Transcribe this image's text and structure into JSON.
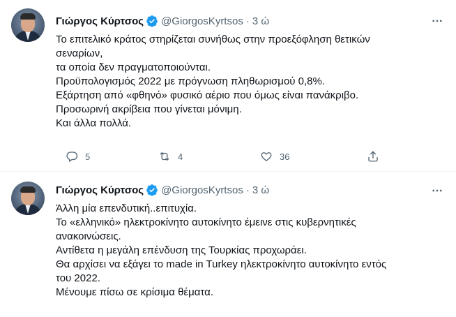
{
  "tweets": [
    {
      "author_name": "Γιώργος Κύρτσος",
      "handle": "@GiorgosKyrtsos",
      "separator": "·",
      "time": "3 ώ",
      "lines": [
        "Το επιτελικό κράτος στηρίζεται συνήθως στην προεξόφληση θετικών",
        "σεναρίων,",
        "τα οποία δεν πραγματοποιούνται.",
        "Προϋπολογισμός 2022 με πρόγνωση πληθωρισμού 0,8%.",
        "Εξάρτηση από «φθηνό» φυσικό αέριο που όμως είναι πανάκριβο.",
        "Προσωρινή ακρίβεια που γίνεται μόνιμη.",
        "Και άλλα πολλά."
      ],
      "reply_count": "5",
      "retweet_count": "4",
      "like_count": "36"
    },
    {
      "author_name": "Γιώργος Κύρτσος",
      "handle": "@GiorgosKyrtsos",
      "separator": "·",
      "time": "3 ώ",
      "lines": [
        "Άλλη μία επενδυτική..επιτυχία.",
        "Το «ελληνικό» ηλεκτροκίνητο αυτοκίνητο έμεινε στις κυβερνητικές",
        "ανακοινώσεις.",
        "Αντίθετα η μεγάλη επένδυση της Τουρκίας προχωράει.",
        "Θα αρχίσει να εξάγει το made in Turkey ηλεκτροκίνητο αυτοκίνητο εντός",
        "του 2022.",
        "Μένουμε πίσω σε κρίσιμα θέματα."
      ]
    }
  ],
  "icons": {
    "verified": "verified-badge-icon",
    "more": "more-dots-icon",
    "reply": "reply-icon",
    "retweet": "retweet-icon",
    "like": "heart-icon",
    "share": "share-icon"
  },
  "colors": {
    "text": "#0f1419",
    "secondary": "#536471",
    "verified": "#1d9bf0",
    "divider": "#eff3f4"
  }
}
